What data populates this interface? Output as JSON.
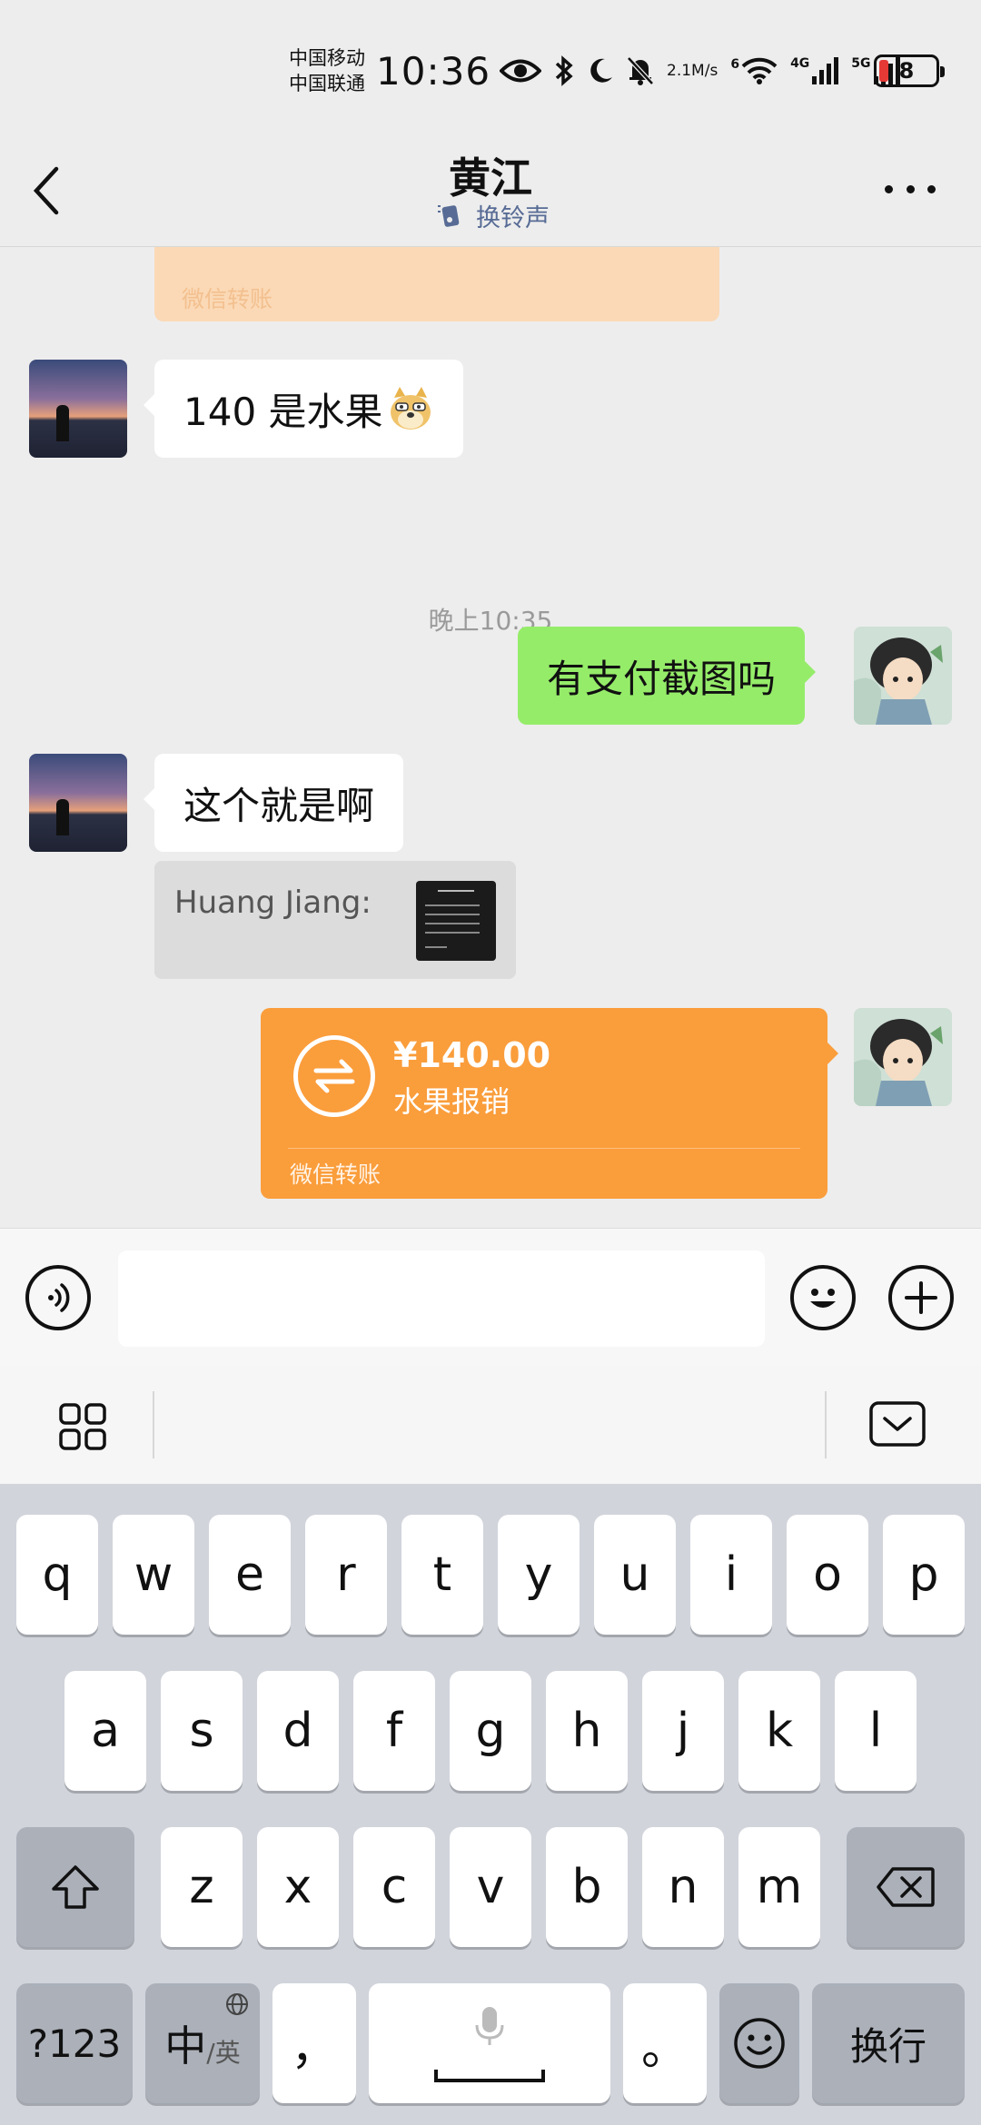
{
  "status_bar": {
    "carrier_1": "中国移动",
    "carrier_2": "中国联通",
    "time": "10:36",
    "net_speed_value": "2.1",
    "net_speed_unit": "M/s",
    "wifi_badge": "6",
    "signal_1_label": "4G",
    "signal_2_label": "5G",
    "battery": "8",
    "icons": [
      "eye-icon",
      "bluetooth-icon",
      "moon-icon",
      "bell-muted-icon",
      "wifi-icon",
      "signal-icon",
      "signal-icon",
      "battery-icon"
    ]
  },
  "header": {
    "title": "黄江",
    "subtitle": "换铃声"
  },
  "chat": {
    "faded_transfer_footer": "微信转账",
    "messages": [
      {
        "side": "left",
        "text": "140 是水果",
        "emoji": "doge"
      },
      {
        "side": "left",
        "text": "这个就是啊"
      }
    ],
    "timestamp": "晚上10:35",
    "my_message": "有支付截图吗",
    "quote": {
      "sender": "Huang Jiang:"
    },
    "transfer": {
      "amount": "¥140.00",
      "note": "水果报销",
      "footer": "微信转账"
    }
  },
  "input": {
    "value": "",
    "placeholder": ""
  },
  "keyboard": {
    "row1": [
      "q",
      "w",
      "e",
      "r",
      "t",
      "y",
      "u",
      "i",
      "o",
      "p"
    ],
    "row2": [
      "a",
      "s",
      "d",
      "f",
      "g",
      "h",
      "j",
      "k",
      "l"
    ],
    "row3": [
      "z",
      "x",
      "c",
      "v",
      "b",
      "n",
      "m"
    ],
    "numbers_key": "?123",
    "lang_key_main": "中",
    "lang_key_sub": "/英",
    "comma_key": "，",
    "period_key": "。",
    "enter_key": "换行"
  }
}
